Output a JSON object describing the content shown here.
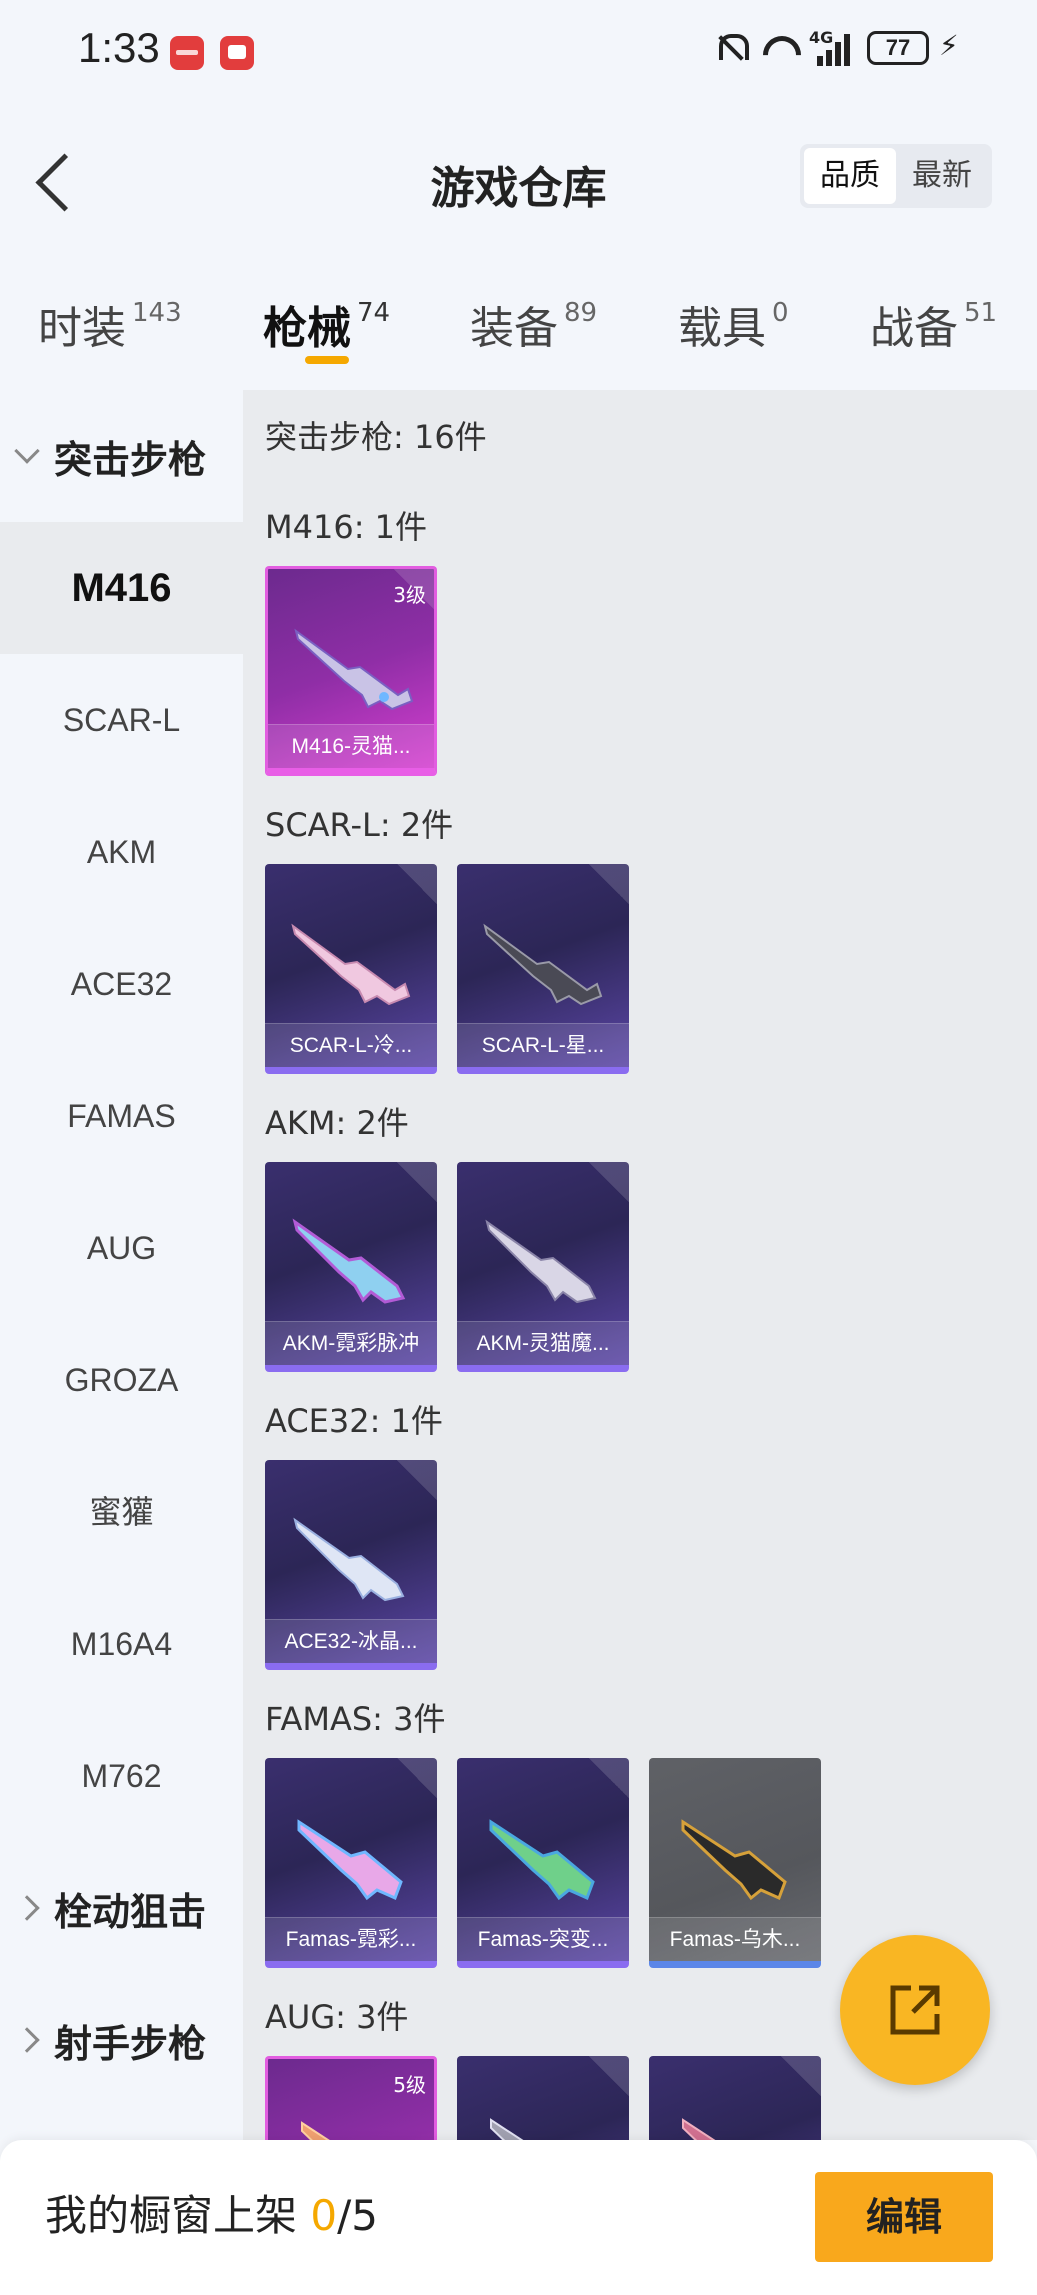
{
  "status_bar": {
    "time": "1:33",
    "network": "4G",
    "battery": "77"
  },
  "header": {
    "title": "游戏仓库",
    "sort_options": [
      "品质",
      "最新"
    ],
    "sort_selected": "品质"
  },
  "tabs": [
    {
      "label": "时装",
      "count": "143"
    },
    {
      "label": "枪械",
      "count": "74",
      "active": true
    },
    {
      "label": "装备",
      "count": "89"
    },
    {
      "label": "载具",
      "count": "0"
    },
    {
      "label": "战备",
      "count": "51"
    }
  ],
  "sidebar": {
    "group_expanded": "突击步枪",
    "items": [
      "M416",
      "SCAR-L",
      "AKM",
      "ACE32",
      "FAMAS",
      "AUG",
      "GROZA",
      "蜜獾",
      "M16A4",
      "M762"
    ],
    "active_item": "M416",
    "groups_collapsed": [
      "栓动狙击",
      "射手步枪"
    ]
  },
  "content": {
    "category_title": "突击步枪: 16件",
    "sections": [
      {
        "title": "M416: 1件",
        "cards": [
          {
            "name": "M416-灵猫...",
            "rarity": "pink",
            "level": "3级"
          }
        ]
      },
      {
        "title": "SCAR-L: 2件",
        "cards": [
          {
            "name": "SCAR-L-冷...",
            "rarity": "blue"
          },
          {
            "name": "SCAR-L-星...",
            "rarity": "blue"
          }
        ]
      },
      {
        "title": "AKM: 2件",
        "cards": [
          {
            "name": "AKM-霓彩脉冲",
            "rarity": "blue"
          },
          {
            "name": "AKM-灵猫魔...",
            "rarity": "blue"
          }
        ]
      },
      {
        "title": "ACE32: 1件",
        "cards": [
          {
            "name": "ACE32-冰晶...",
            "rarity": "blue"
          }
        ]
      },
      {
        "title": "FAMAS: 3件",
        "cards": [
          {
            "name": "Famas-霓彩...",
            "rarity": "blue"
          },
          {
            "name": "Famas-突变...",
            "rarity": "blue"
          },
          {
            "name": "Famas-乌木...",
            "rarity": "gray"
          }
        ]
      },
      {
        "title": "AUG: 3件",
        "cards": [
          {
            "name": "",
            "rarity": "pink",
            "level": "5级"
          },
          {
            "name": "",
            "rarity": "blue"
          },
          {
            "name": "",
            "rarity": "blue"
          }
        ]
      }
    ]
  },
  "bottom_bar": {
    "label": "我的橱窗上架 ",
    "count_current": "0",
    "count_total": "/5",
    "edit_label": "编辑"
  },
  "colors": {
    "accent": "#f5a800",
    "rarity_pink": "#e25de0",
    "rarity_blue": "#8a6cf0",
    "rarity_gray": "#5b86e8"
  }
}
